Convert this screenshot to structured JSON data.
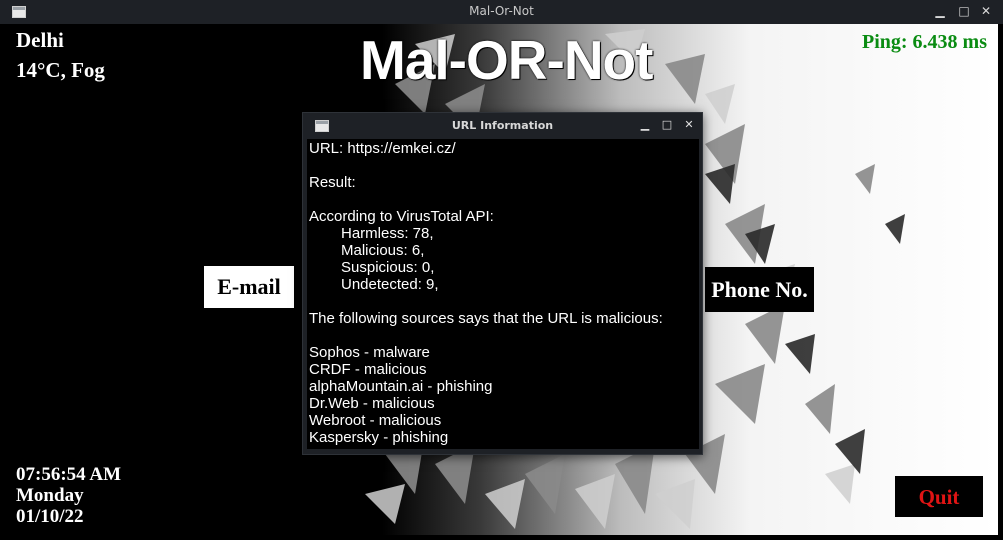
{
  "window": {
    "title": "Mal-Or-Not",
    "minimize_glyph": "▁",
    "maximize_glyph": "□",
    "close_glyph": "✕"
  },
  "weather": {
    "city": "Delhi",
    "condition": "14°C, Fog"
  },
  "app_title": "Mal-OR-Not",
  "ping": "Ping: 6.438 ms",
  "buttons": {
    "email": "E-mail",
    "phone": "Phone No.",
    "quit": "Quit"
  },
  "clock": {
    "time": "07:56:54 AM",
    "day": "Monday",
    "date": "01/10/22"
  },
  "dialog": {
    "title": "URL Information",
    "url_line": "URL: https://emkei.cz/",
    "result_label": "Result:",
    "api_label": "According to VirusTotal API:",
    "stats": [
      "Harmless: 78,",
      "Malicious: 6,",
      "Suspicious: 0,",
      "Undetected: 9,"
    ],
    "sources_intro": "The following sources says that the URL is malicious:",
    "sources": [
      "Sophos - malware",
      "CRDF - malicious",
      "alphaMountain.ai - phishing",
      "Dr.Web - malicious",
      "Webroot - malicious",
      "Kaspersky - phishing"
    ]
  },
  "colors": {
    "ping": "#0a8c12",
    "quit": "#e01414",
    "titlebar": "#1e2126"
  },
  "icons": [
    "window-icon",
    "minimize-icon",
    "maximize-icon",
    "close-icon"
  ]
}
